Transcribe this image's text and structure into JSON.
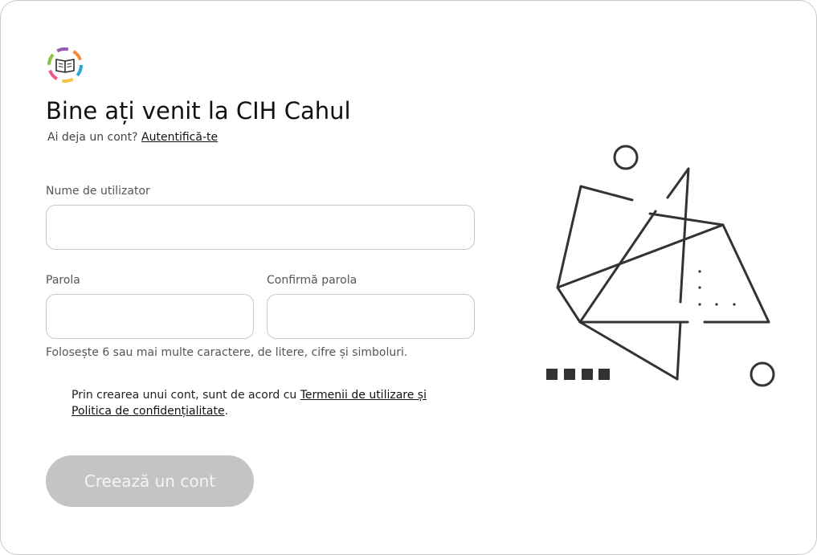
{
  "brand": {
    "logo_icon": "open-book-icon",
    "ring_colors": [
      "#2aa7d9",
      "#f6c445",
      "#ef5a8a",
      "#8bc34a",
      "#9b59b6",
      "#f58a3a"
    ]
  },
  "header": {
    "title": "Bine ați venit la CIH Cahul",
    "prompt": "Ai deja un cont?",
    "login_link": "Autentifică-te"
  },
  "form": {
    "username": {
      "label": "Nume de utilizator",
      "value": ""
    },
    "password": {
      "label": "Parola",
      "value": ""
    },
    "confirm_password": {
      "label": "Confirmă parola",
      "value": ""
    },
    "password_hint": "Folosește 6 sau mai multe caractere, de litere, cifre și simboluri.",
    "terms": {
      "prefix": "Prin crearea unui cont, sunt de acord cu ",
      "link_terms": "Termenii de utilizare și ",
      "link_privacy": "Politica de confidențialitate",
      "suffix": "."
    },
    "submit_label": "Creează un cont"
  },
  "colors": {
    "button_disabled": "#c4c4c4",
    "illustration_stroke": "#333333"
  }
}
